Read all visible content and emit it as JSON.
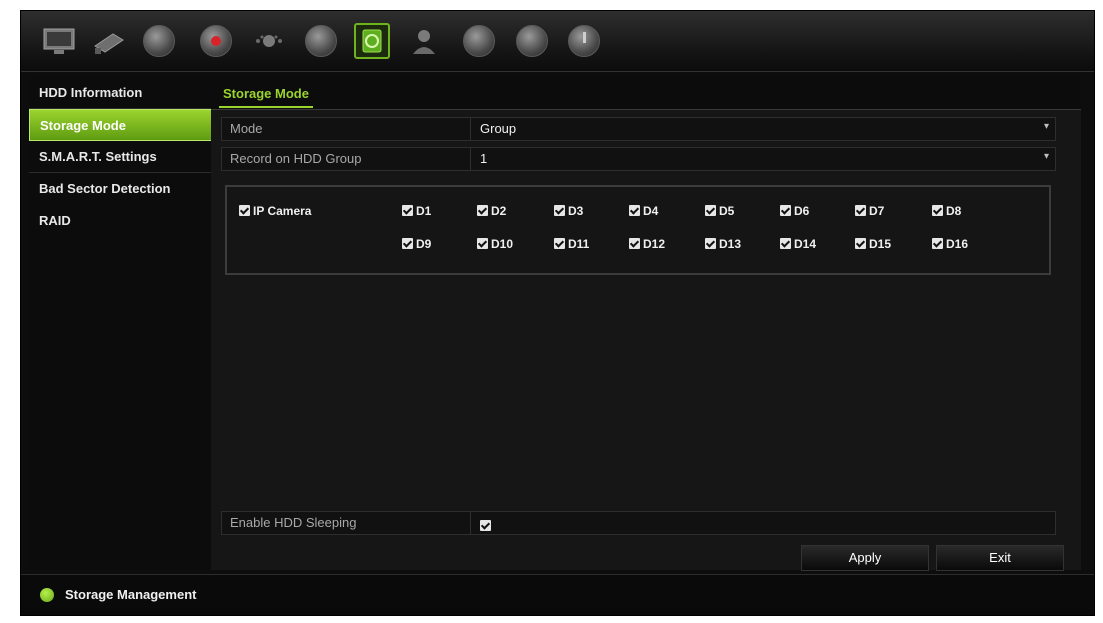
{
  "toolbar": {
    "icons": [
      "monitor-icon",
      "camera-icon",
      "network-icon",
      "record-icon",
      "alarm-icon",
      "device-icon",
      "storage-icon",
      "user-icon",
      "system-icon",
      "maintenance-icon",
      "power-icon"
    ],
    "selected": "storage-icon"
  },
  "sidebar": {
    "items": [
      {
        "label": "HDD Information"
      },
      {
        "label": "Storage Mode"
      },
      {
        "label": "S.M.A.R.T. Settings"
      },
      {
        "label": "Bad Sector Detection"
      },
      {
        "label": "RAID"
      }
    ],
    "active_index": 1
  },
  "main": {
    "tab": "Storage Mode",
    "mode_label": "Mode",
    "mode_value": "Group",
    "record_label": "Record on HDD Group",
    "record_value": "1",
    "ip_camera_label": "IP Camera",
    "channels": [
      "D1",
      "D2",
      "D3",
      "D4",
      "D5",
      "D6",
      "D7",
      "D8",
      "D9",
      "D10",
      "D11",
      "D12",
      "D13",
      "D14",
      "D15",
      "D16"
    ],
    "sleep_label": "Enable HDD Sleeping",
    "apply_label": "Apply",
    "exit_label": "Exit"
  },
  "status": {
    "text": "Storage Management"
  },
  "colors": {
    "accent": "#9bd42e",
    "background": "#0d0d0d"
  }
}
